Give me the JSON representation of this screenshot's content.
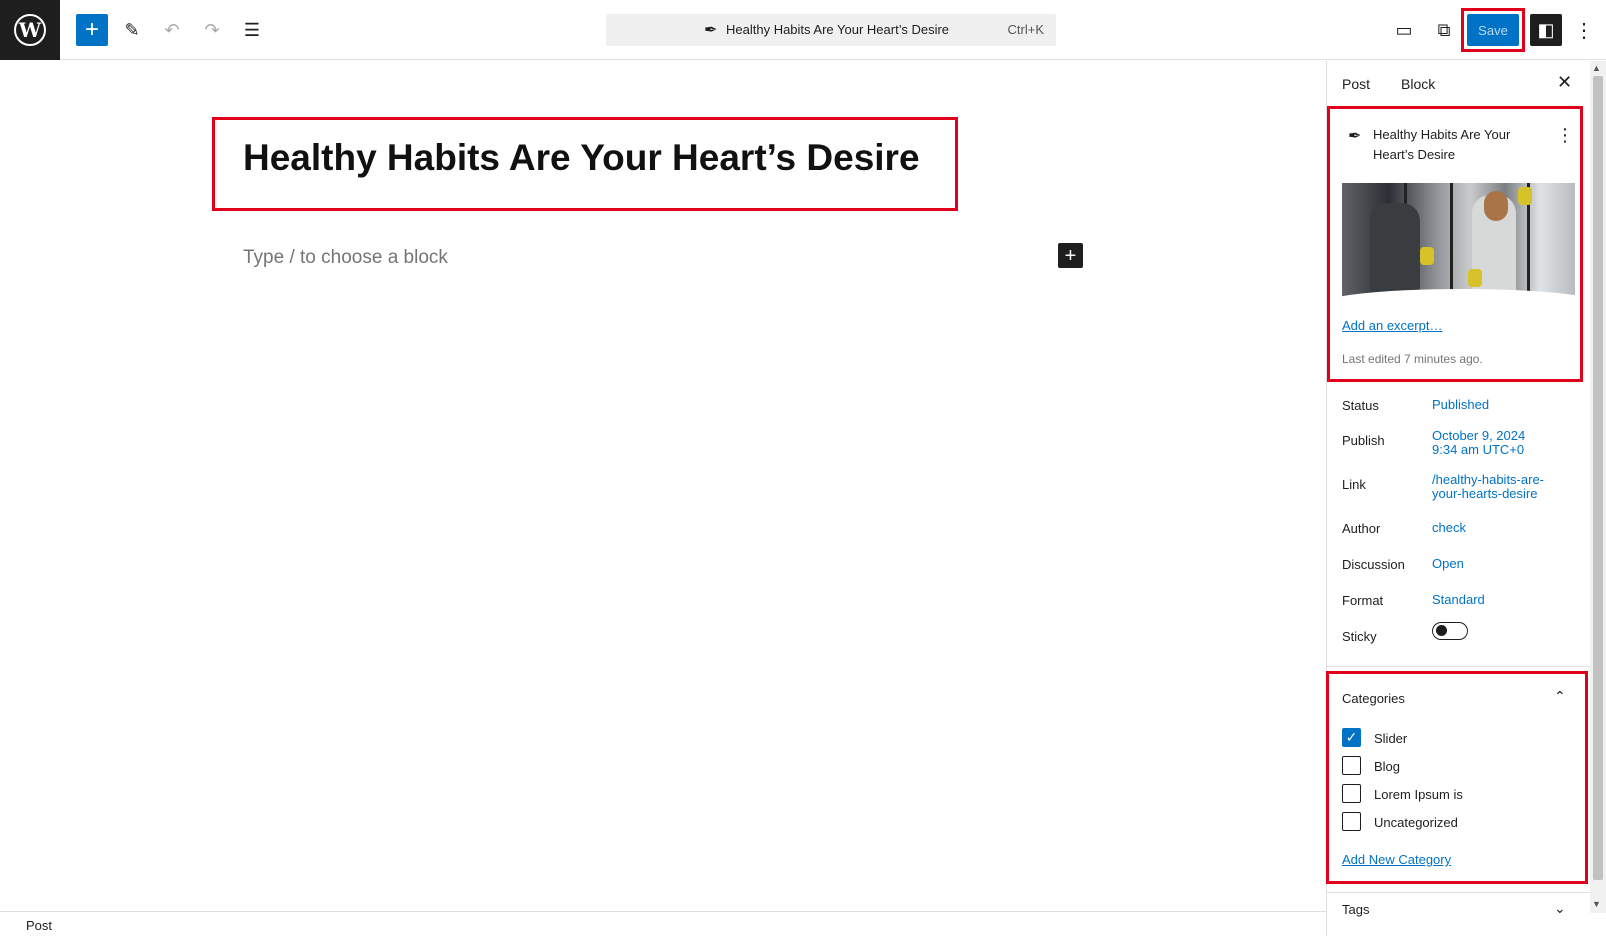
{
  "colors": {
    "accent": "#0073c6",
    "highlight": "#e0001b",
    "dark": "#1e1e1e"
  },
  "topbar": {
    "logo_letter": "W",
    "add_icon": "+",
    "pen_icon": "✎",
    "undo_icon": "↶",
    "redo_icon": "↷",
    "list_icon": "☰",
    "command_title": "Healthy Habits Are Your Heart’s Desire",
    "command_shortcut": "Ctrl+K",
    "view_icon": "▭",
    "external_icon": "⧉",
    "save_label": "Save",
    "panel_icon": "◧",
    "more_icon": "⋮"
  },
  "editor": {
    "post_title": "Healthy Habits Are Your Heart’s Desire",
    "block_placeholder": "Type / to choose a block",
    "inline_add_icon": "+"
  },
  "footer": {
    "breadcrumb": "Post"
  },
  "sidebar": {
    "tab_post": "Post",
    "tab_block": "Block",
    "close_icon": "✕",
    "summary": {
      "title": "Healthy Habits Are Your Heart’s Desire",
      "menu_icon": "⋮",
      "add_excerpt": "Add an excerpt…",
      "last_edited": "Last edited 7 minutes ago."
    },
    "meta": {
      "status_label": "Status",
      "status_value": "Published",
      "publish_label": "Publish",
      "publish_date": "October 9, 2024",
      "publish_time": "9:34 am UTC+0",
      "link_label": "Link",
      "link_line1": "/healthy-habits-are-",
      "link_line2": "your-hearts-desire",
      "author_label": "Author",
      "author_value": "check",
      "discussion_label": "Discussion",
      "discussion_value": "Open",
      "format_label": "Format",
      "format_value": "Standard",
      "sticky_label": "Sticky",
      "sticky_on": false
    },
    "categories": {
      "title": "Categories",
      "chevron_icon": "⌃",
      "items": [
        {
          "label": "Slider",
          "checked": true
        },
        {
          "label": "Blog",
          "checked": false
        },
        {
          "label": "Lorem Ipsum is",
          "checked": false
        },
        {
          "label": "Uncategorized",
          "checked": false
        }
      ],
      "add_new": "Add New Category"
    },
    "tags": {
      "title": "Tags",
      "chevron_icon": "⌄"
    }
  }
}
